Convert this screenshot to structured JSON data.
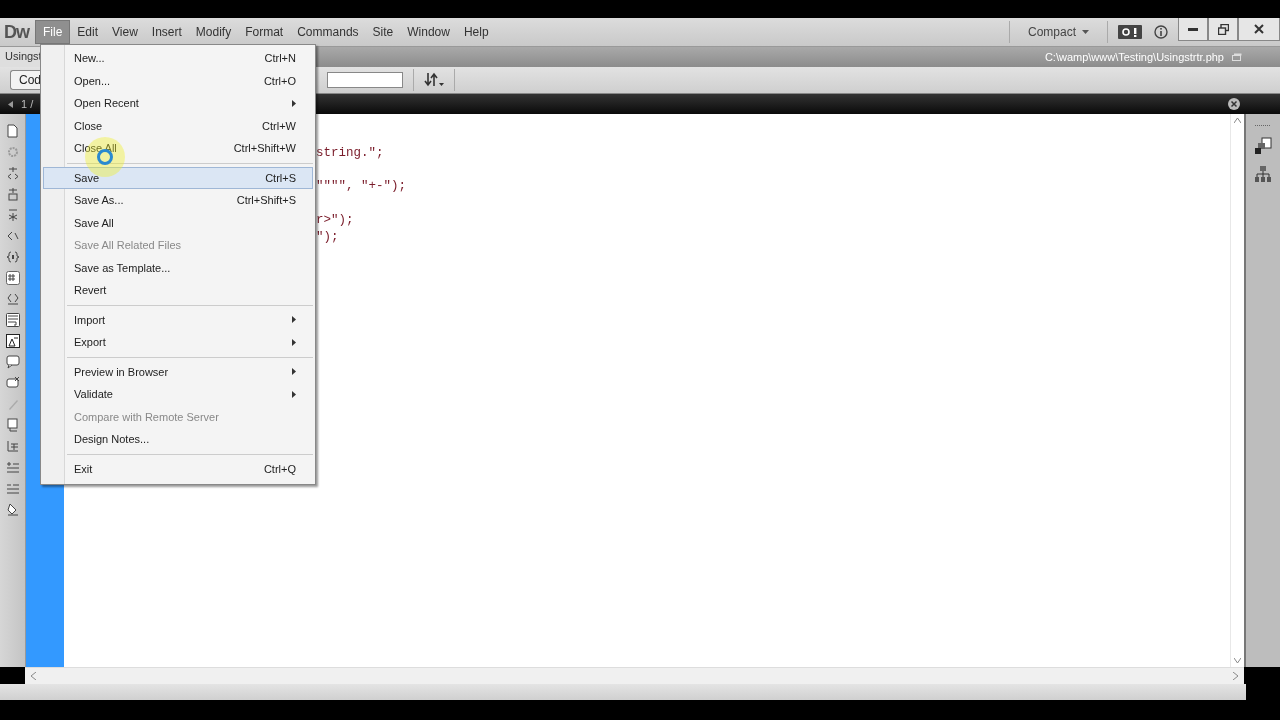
{
  "menubar": {
    "logo": "Dw",
    "menus": [
      {
        "label": "File",
        "selected": true
      },
      {
        "label": "Edit",
        "selected": false
      },
      {
        "label": "View",
        "selected": false
      },
      {
        "label": "Insert",
        "selected": false
      },
      {
        "label": "Modify",
        "selected": false
      },
      {
        "label": "Format",
        "selected": false
      },
      {
        "label": "Commands",
        "selected": false
      },
      {
        "label": "Site",
        "selected": false
      },
      {
        "label": "Window",
        "selected": false
      },
      {
        "label": "Help",
        "selected": false
      }
    ],
    "workspace": "Compact"
  },
  "document_tab": {
    "label": "Usingst",
    "path": "C:\\wamp\\www\\Testing\\Usingstrtr.php"
  },
  "toolbar": {
    "view_button": "Cod"
  },
  "related_bar": {
    "label": "1 /"
  },
  "code_lines": [
    {
      "kind": "blank"
    },
    {
      "kind": "code",
      "text": "string.\";"
    },
    {
      "kind": "blank"
    },
    {
      "kind": "code",
      "text": "\"\"\"\", \"+-\");"
    },
    {
      "kind": "blank"
    },
    {
      "kind": "code",
      "text": "r>\");"
    },
    {
      "kind": "code",
      "text": "\");"
    }
  ],
  "file_menu": {
    "items": [
      {
        "kind": "item",
        "label": "New...",
        "shortcut": "Ctrl+N",
        "submenu": false,
        "disabled": false,
        "selected": false
      },
      {
        "kind": "item",
        "label": "Open...",
        "shortcut": "Ctrl+O",
        "submenu": false,
        "disabled": false,
        "selected": false
      },
      {
        "kind": "item",
        "label": "Open Recent",
        "submenu": true,
        "disabled": false,
        "selected": false
      },
      {
        "kind": "item",
        "label": "Close",
        "shortcut": "Ctrl+W",
        "submenu": false,
        "disabled": false,
        "selected": false
      },
      {
        "kind": "item",
        "label": "Close All",
        "shortcut": "Ctrl+Shift+W",
        "submenu": false,
        "disabled": false,
        "selected": false
      },
      {
        "kind": "separator"
      },
      {
        "kind": "item",
        "label": "Save",
        "shortcut": "Ctrl+S",
        "submenu": false,
        "disabled": false,
        "selected": true
      },
      {
        "kind": "item",
        "label": "Save As...",
        "shortcut": "Ctrl+Shift+S",
        "submenu": false,
        "disabled": false,
        "selected": false
      },
      {
        "kind": "item",
        "label": "Save All",
        "submenu": false,
        "disabled": false,
        "selected": false
      },
      {
        "kind": "item",
        "label": "Save All Related Files",
        "submenu": false,
        "disabled": true,
        "selected": false
      },
      {
        "kind": "item",
        "label": "Save as Template...",
        "submenu": false,
        "disabled": false,
        "selected": false
      },
      {
        "kind": "item",
        "label": "Revert",
        "submenu": false,
        "disabled": false,
        "selected": false
      },
      {
        "kind": "separator"
      },
      {
        "kind": "item",
        "label": "Import",
        "submenu": true,
        "disabled": false,
        "selected": false
      },
      {
        "kind": "item",
        "label": "Export",
        "submenu": true,
        "disabled": false,
        "selected": false
      },
      {
        "kind": "separator"
      },
      {
        "kind": "item",
        "label": "Preview in Browser",
        "submenu": true,
        "disabled": false,
        "selected": false
      },
      {
        "kind": "item",
        "label": "Validate",
        "submenu": true,
        "disabled": false,
        "selected": false
      },
      {
        "kind": "item",
        "label": "Compare with Remote Server",
        "submenu": false,
        "disabled": true,
        "selected": false
      },
      {
        "kind": "item",
        "label": "Design Notes...",
        "submenu": false,
        "disabled": false,
        "selected": false
      },
      {
        "kind": "separator"
      },
      {
        "kind": "item",
        "label": "Exit",
        "shortcut": "Ctrl+Q",
        "submenu": false,
        "disabled": false,
        "selected": false
      }
    ]
  }
}
